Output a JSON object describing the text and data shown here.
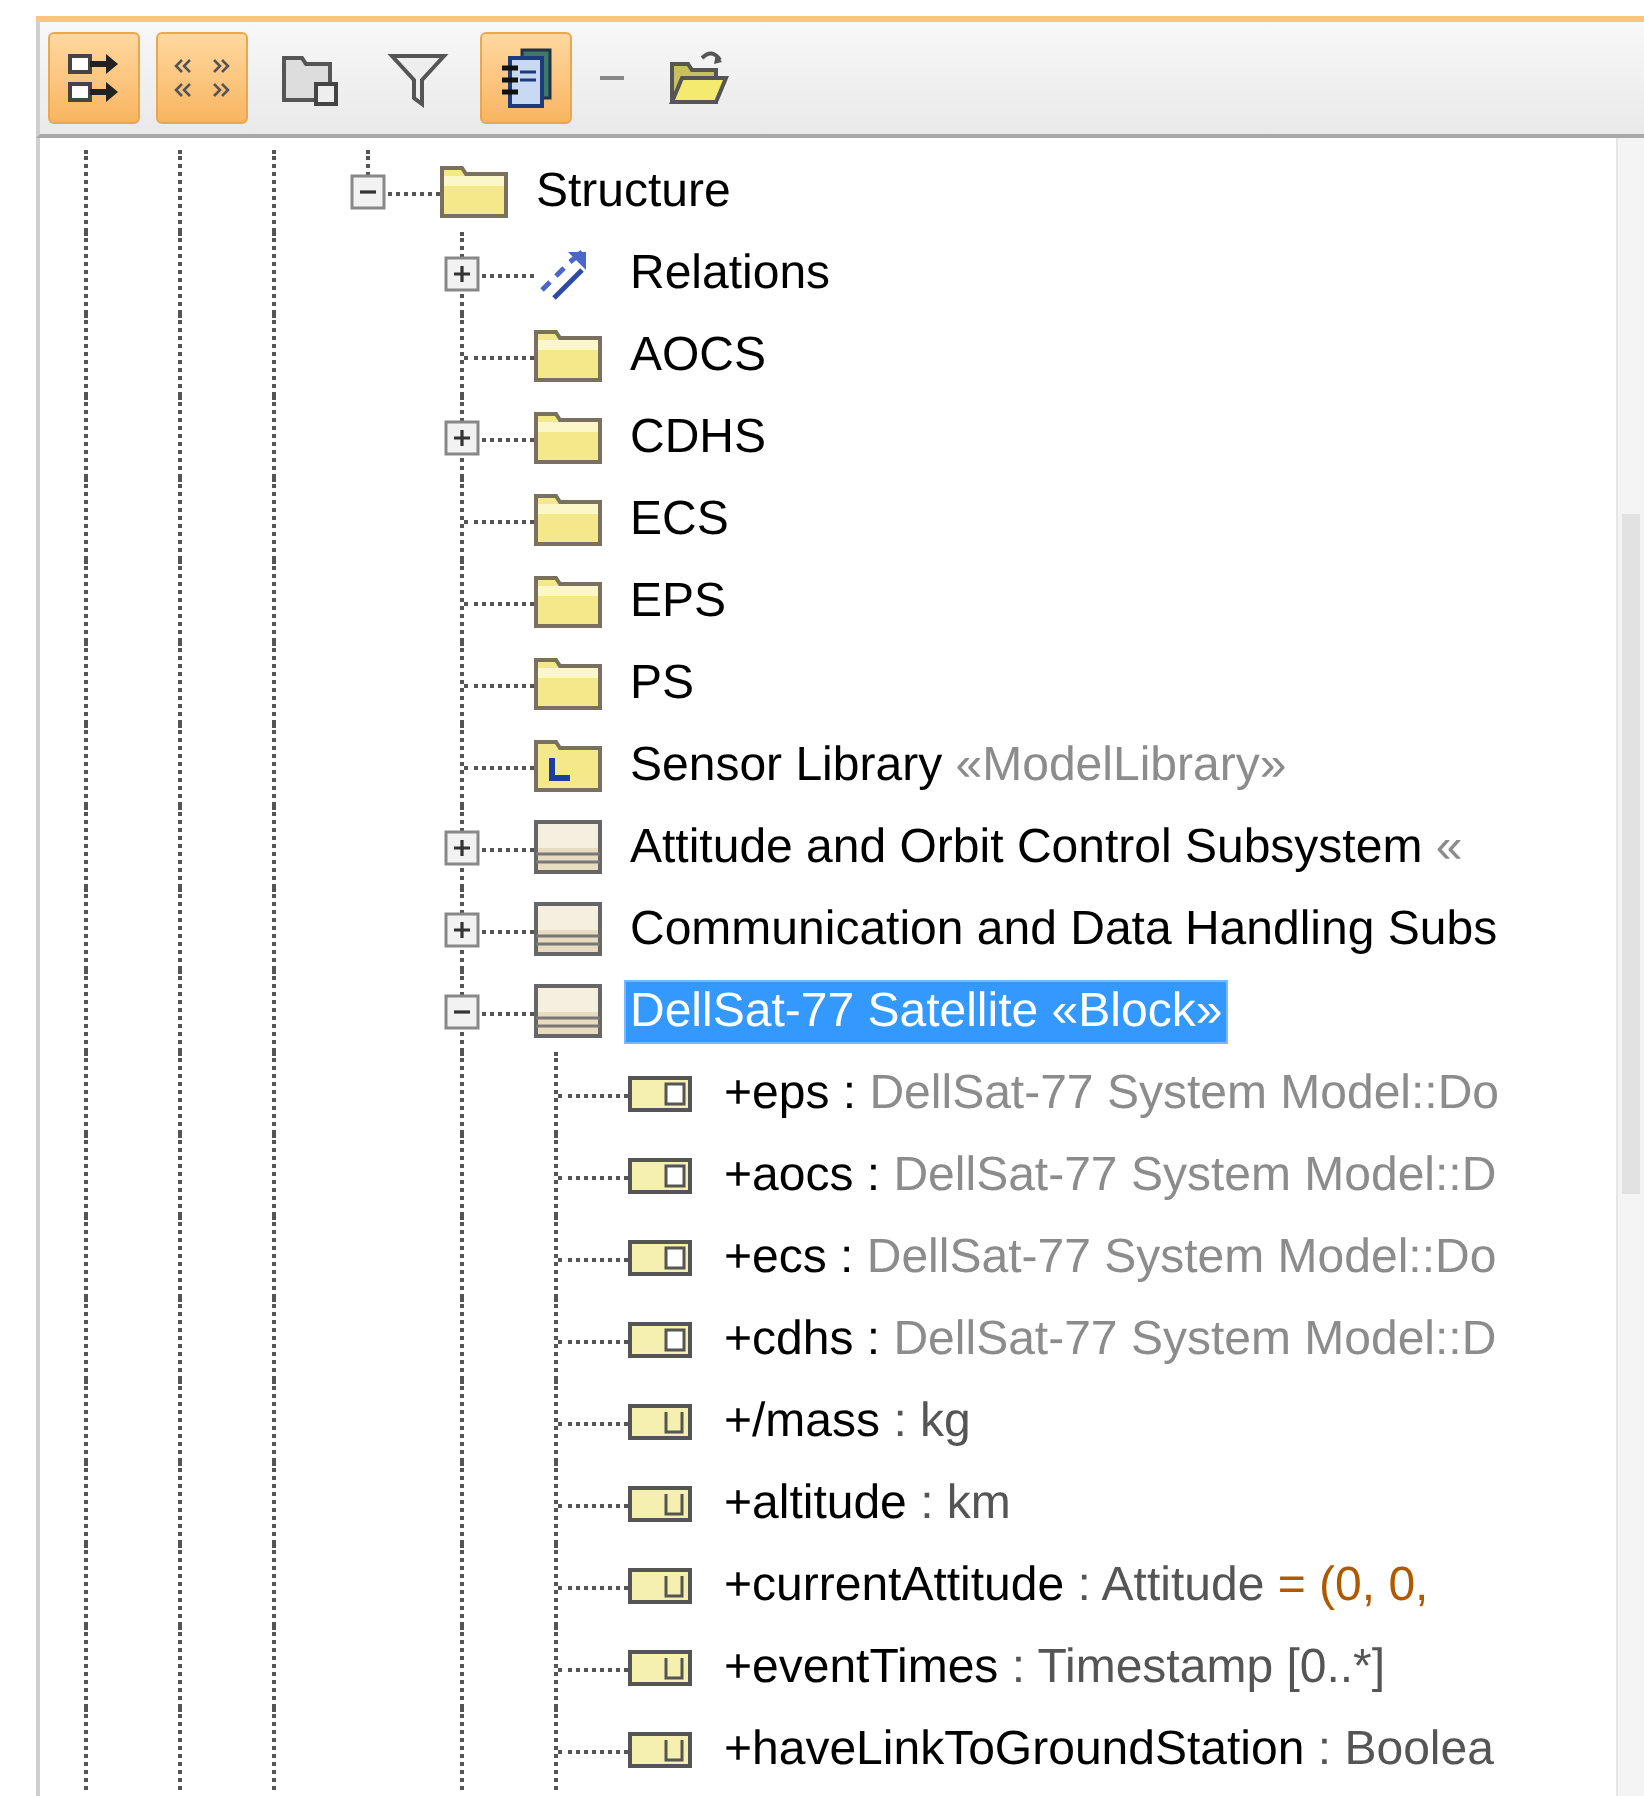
{
  "toolbar": [
    {
      "kind": "arrows",
      "selected": true
    },
    {
      "kind": "brackets",
      "selected": true
    },
    {
      "kind": "package",
      "selected": false
    },
    {
      "kind": "filter",
      "selected": false
    },
    {
      "kind": "notebook",
      "selected": true
    },
    {
      "kind": "separator"
    },
    {
      "kind": "open",
      "selected": false
    }
  ],
  "tree": [
    {
      "kind": "folder",
      "selected": false,
      "expanded": true,
      "label": [
        {
          "text": "Structure",
          "kind": "name"
        }
      ],
      "children": [
        {
          "kind": "relations",
          "selected": false,
          "expanded": false,
          "label": [
            {
              "text": "Relations",
              "kind": "name"
            }
          ]
        },
        {
          "kind": "folder",
          "selected": false,
          "label": [
            {
              "text": "AOCS",
              "kind": "name"
            }
          ]
        },
        {
          "kind": "folder",
          "selected": false,
          "expanded": false,
          "label": [
            {
              "text": "CDHS",
              "kind": "name"
            }
          ]
        },
        {
          "kind": "folder",
          "selected": false,
          "label": [
            {
              "text": "ECS",
              "kind": "name"
            }
          ]
        },
        {
          "kind": "folder",
          "selected": false,
          "label": [
            {
              "text": "EPS",
              "kind": "name"
            }
          ]
        },
        {
          "kind": "folder",
          "selected": false,
          "label": [
            {
              "text": "PS",
              "kind": "name"
            }
          ]
        },
        {
          "kind": "library",
          "selected": false,
          "label": [
            {
              "text": "Sensor Library ",
              "kind": "name"
            },
            {
              "text": "«ModelLibrary»",
              "kind": "muted"
            }
          ]
        },
        {
          "kind": "block",
          "selected": false,
          "expanded": false,
          "label": [
            {
              "text": "Attitude and Orbit Control Subsystem ",
              "kind": "name"
            },
            {
              "text": "«",
              "kind": "muted"
            }
          ]
        },
        {
          "kind": "block",
          "selected": false,
          "expanded": false,
          "label": [
            {
              "text": "Communication and Data Handling Subs",
              "kind": "name"
            }
          ]
        },
        {
          "kind": "block",
          "selected": true,
          "expanded": true,
          "label": [
            {
              "text": "DellSat-77 Satellite ",
              "kind": "name"
            },
            {
              "text": "«Block»",
              "kind": "muted"
            }
          ],
          "children": [
            {
              "kind": "part",
              "selected": false,
              "label": [
                {
                  "text": "+eps : ",
                  "kind": "name"
                },
                {
                  "text": "DellSat-77 System Model::Do",
                  "kind": "muted"
                }
              ]
            },
            {
              "kind": "part",
              "selected": false,
              "label": [
                {
                  "text": "+aocs : ",
                  "kind": "name"
                },
                {
                  "text": "DellSat-77 System Model::D",
                  "kind": "muted"
                }
              ]
            },
            {
              "kind": "part",
              "selected": false,
              "label": [
                {
                  "text": "+ecs : ",
                  "kind": "name"
                },
                {
                  "text": "DellSat-77 System Model::Do",
                  "kind": "muted"
                }
              ]
            },
            {
              "kind": "part",
              "selected": false,
              "label": [
                {
                  "text": "+cdhs : ",
                  "kind": "name"
                },
                {
                  "text": "DellSat-77 System Model::D",
                  "kind": "muted"
                }
              ]
            },
            {
              "kind": "value",
              "selected": false,
              "label": [
                {
                  "text": "+/mass",
                  "kind": "name"
                },
                {
                  "text": " : kg",
                  "kind": "type"
                }
              ]
            },
            {
              "kind": "value",
              "selected": false,
              "label": [
                {
                  "text": "+altitude",
                  "kind": "name"
                },
                {
                  "text": " : km",
                  "kind": "type"
                }
              ]
            },
            {
              "kind": "value",
              "selected": false,
              "label": [
                {
                  "text": "+currentAttitude",
                  "kind": "name"
                },
                {
                  "text": " : Attitude ",
                  "kind": "type"
                },
                {
                  "text": "= (0, 0,",
                  "kind": "default"
                }
              ]
            },
            {
              "kind": "value",
              "selected": false,
              "label": [
                {
                  "text": "+eventTimes",
                  "kind": "name"
                },
                {
                  "text": " : Timestamp [0..*]",
                  "kind": "type"
                }
              ]
            },
            {
              "kind": "value",
              "selected": false,
              "label": [
                {
                  "text": "+haveLinkToGroundStation",
                  "kind": "name"
                },
                {
                  "text": " : Boolea",
                  "kind": "type"
                }
              ]
            }
          ]
        }
      ]
    }
  ]
}
